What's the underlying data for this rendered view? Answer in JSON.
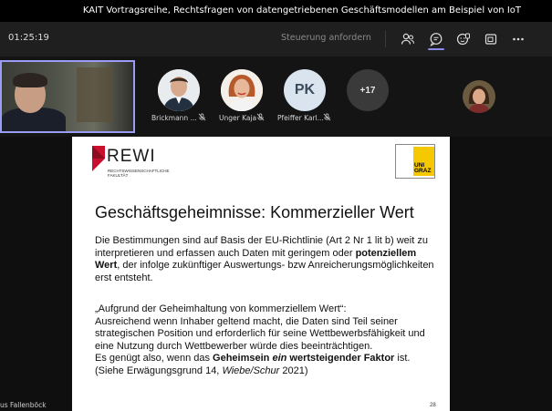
{
  "window": {
    "title": "KAIT Vortragsreihe, Rechtsfragen von datengetriebenen Geschäftsmodellen am Beispiel von IoT"
  },
  "toolbar": {
    "timer": "01:25:19",
    "request_control": "Steuerung anfordern",
    "buttons": [
      "people-icon",
      "chat-icon",
      "reactions-icon",
      "share-icon",
      "more-icon"
    ]
  },
  "participants": [
    {
      "name": "Brickmann ...",
      "muted": true
    },
    {
      "name": "Unger Kaja",
      "muted": true
    },
    {
      "name": "Pfeiffer Karl...",
      "initials": "PK",
      "muted": true
    }
  ],
  "overflow_count": "+17",
  "presenter_name": "us Fallenböck",
  "slide": {
    "logo": "REWI",
    "logo_subtitle": "RECHTSWISSENSCHAFTLICHE FAKULTÄT",
    "uni_logo": "UNI GRAZ",
    "title": "Geschäftsgeheimnisse: Kommerzieller Wert",
    "p1_a": "Die Bestimmungen sind auf Basis der EU-Richtlinie (Art 2 Nr 1 lit b) weit zu interpretieren und erfassen auch Daten mit geringem oder ",
    "p1_b": "potenziellem Wert",
    "p1_c": ", der infolge zukünftiger Auswertungs- bzw Anreicherungsmöglichkeiten erst entsteht.",
    "p2_quote": "„Aufgrund der Geheimhaltung von kommerziellem Wert“:",
    "p2_body": "Ausreichend wenn Inhaber geltend macht, die Daten sind Teil seiner strategischen Position und erforderlich für seine Wettbewerbsfähigkeit und eine Nutzung durch Wettbewerber würde dies beeinträchtigen.",
    "p3_a": "Es genügt also, wenn das ",
    "p3_b": "Geheimsein ",
    "p3_c": "ein",
    "p3_d": " wertsteigender Faktor",
    "p3_e": " ist.",
    "p4_a": "(Siehe Erwägungsgrund 14, ",
    "p4_b": "Wiebe/Schur",
    "p4_c": " 2021)",
    "page_number": "28"
  },
  "colors": {
    "accent": "#8b8cf0",
    "rewi_red": "#c8102e",
    "uni_yellow": "#f5c800"
  }
}
